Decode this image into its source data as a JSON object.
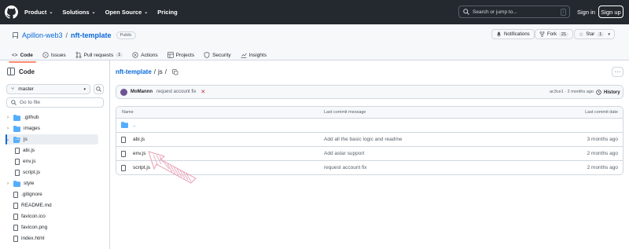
{
  "header": {
    "nav": [
      "Product",
      "Solutions",
      "Open Source",
      "Pricing"
    ],
    "search_placeholder": "Search or jump to...",
    "search_hotkey": "/",
    "sign_in": "Sign in",
    "sign_up": "Sign up"
  },
  "repo": {
    "owner": "Apillon-web3",
    "separator": "/",
    "name": "nft-template",
    "visibility": "Public",
    "notifications_label": "Notifications",
    "fork_label": "Fork",
    "fork_count": "21",
    "star_label": "Star",
    "star_count": "1"
  },
  "tabs": [
    {
      "label": "Code",
      "icon": "code-icon",
      "selected": true
    },
    {
      "label": "Issues",
      "icon": "issue-icon"
    },
    {
      "label": "Pull requests",
      "icon": "pull-request-icon",
      "count": "1"
    },
    {
      "label": "Actions",
      "icon": "play-icon"
    },
    {
      "label": "Projects",
      "icon": "table-icon"
    },
    {
      "label": "Security",
      "icon": "shield-icon"
    },
    {
      "label": "Insights",
      "icon": "graph-icon"
    }
  ],
  "sidebar": {
    "title": "Code",
    "branch": "master",
    "goto_placeholder": "Go to file",
    "tree": [
      {
        "label": ".github",
        "type": "folder",
        "depth": 0
      },
      {
        "label": "images",
        "type": "folder",
        "depth": 0
      },
      {
        "label": "js",
        "type": "folder-open",
        "depth": 0,
        "selected": true
      },
      {
        "label": "abi.js",
        "type": "file",
        "depth": 1
      },
      {
        "label": "env.js",
        "type": "file",
        "depth": 1
      },
      {
        "label": "script.js",
        "type": "file",
        "depth": 1
      },
      {
        "label": "style",
        "type": "folder",
        "depth": 0
      },
      {
        "label": ".gitignore",
        "type": "file",
        "depth": 0
      },
      {
        "label": "README.md",
        "type": "file",
        "depth": 0
      },
      {
        "label": "favicon.ico",
        "type": "file",
        "depth": 0
      },
      {
        "label": "favicon.png",
        "type": "file",
        "depth": 0
      },
      {
        "label": "index.html",
        "type": "file",
        "depth": 0
      }
    ]
  },
  "breadcrumb": {
    "repo": "nft-template",
    "sep1": "/",
    "folder": "js",
    "sep2": "/"
  },
  "commit": {
    "author": "MoMannn",
    "message": "request account fix",
    "status": "✕",
    "sha_time": "ac3ce1 · 2 months ago",
    "history": "History"
  },
  "table": {
    "headers": {
      "name": "Name",
      "message": "Last commit message",
      "date": "Last commit date"
    },
    "parent": "..",
    "rows": [
      {
        "name": "abi.js",
        "message": "Add all the basic logic and readme",
        "date": "3 months ago"
      },
      {
        "name": "env.js",
        "message": "Add astar support",
        "date": "2 months ago"
      },
      {
        "name": "script.js",
        "message": "request account fix",
        "date": "2 months ago"
      }
    ]
  },
  "colors": {
    "header_bg": "#24292f",
    "link": "#0969da",
    "tab_underline": "#fd8c73",
    "folder": "#54aeff",
    "annotation_arrow": "#e8a0b4"
  }
}
